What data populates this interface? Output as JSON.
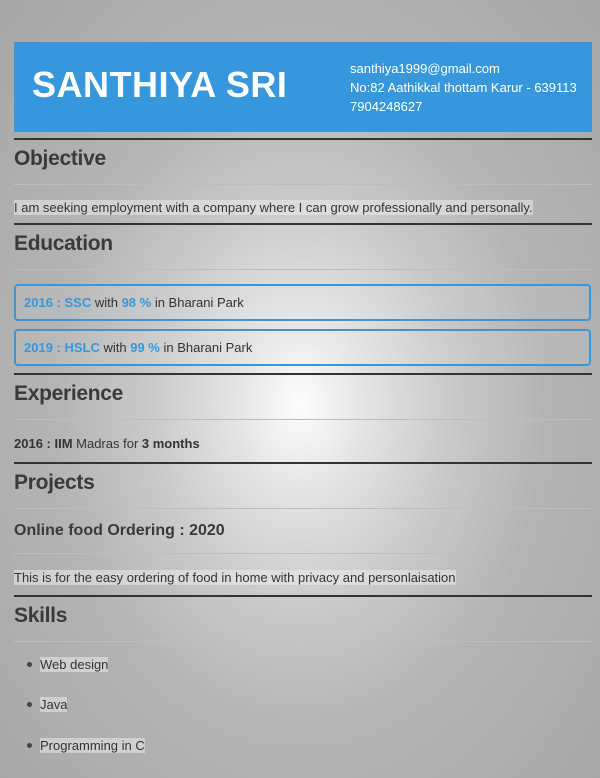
{
  "header": {
    "name": "SANTHIYA SRI",
    "email": "santhiya1999@gmail.com",
    "address": "No:82 Aathikkal thottam Karur - 639113",
    "phone": "7904248627",
    "color": "#3697dc"
  },
  "objective": {
    "heading": "Objective",
    "text": "I am seeking employment with a company where I can grow professionally and personally."
  },
  "education": {
    "heading": "Education",
    "items": [
      {
        "year": "2016",
        "sep": " : ",
        "level": "SSC",
        "with": " with ",
        "score": "98 %",
        "in": " in ",
        "school": "Bharani Park"
      },
      {
        "year": "2019",
        "sep": " : ",
        "level": "HSLC",
        "with": " with ",
        "score": "99 %",
        "in": " in ",
        "school": "Bharani Park"
      }
    ]
  },
  "experience": {
    "heading": "Experience",
    "year": "2016 : IIM",
    "place": " Madras for ",
    "duration": "3 months"
  },
  "projects": {
    "heading": "Projects",
    "title": "Online food Ordering : 2020",
    "description": "This is for the easy ordering of food in home with privacy and personlaisation"
  },
  "skills": {
    "heading": "Skills",
    "items": [
      "Web design",
      "Java",
      "Programming in C"
    ]
  }
}
